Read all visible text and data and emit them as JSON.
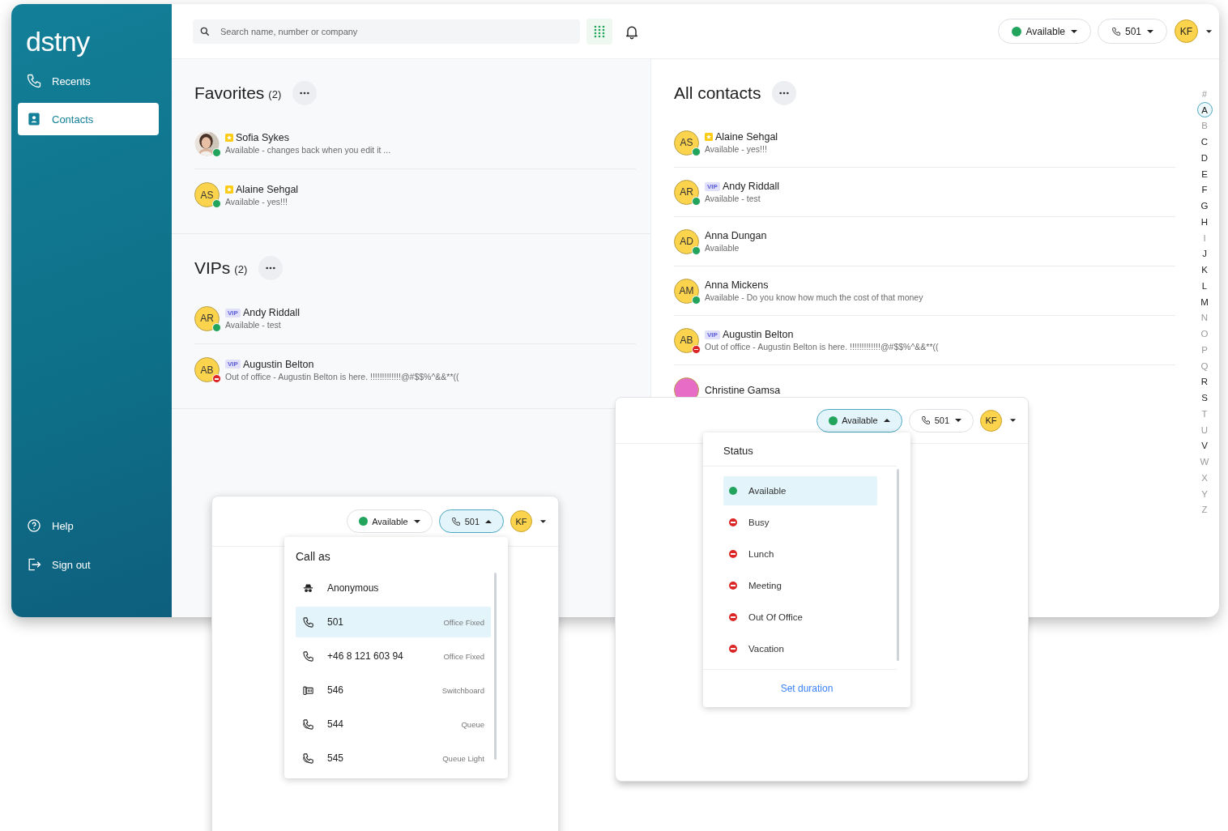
{
  "sidebar": {
    "logo": "dstny",
    "nav": [
      {
        "label": "Recents",
        "kind": "phone",
        "selected": false
      },
      {
        "label": "Contacts",
        "kind": "contacts",
        "selected": true
      }
    ],
    "footer": [
      {
        "label": "Help",
        "kind": "help"
      },
      {
        "label": "Sign out",
        "kind": "signout"
      }
    ]
  },
  "topbar": {
    "search": {
      "placeholder": "Search name, number or company"
    },
    "status": {
      "label": "Available",
      "color": "#22a45d",
      "open": false
    },
    "line": {
      "label": "501",
      "open": false
    },
    "user": {
      "initials": "KF"
    }
  },
  "sections": [
    {
      "title": "Favorites",
      "count": "(2)",
      "contacts": [
        {
          "name": "Sofia Sykes",
          "status": "Available - changes back when you edit it ...",
          "photo": true,
          "away": false,
          "badge": {
            "kind": "favorite"
          }
        },
        {
          "name": "Alaine Sehgal",
          "status": "Available - yes!!!",
          "initials": "AS",
          "color": "#fcd34d",
          "away": false,
          "badge": {
            "kind": "favorite"
          }
        }
      ]
    },
    {
      "title": "VIPs",
      "count": "(2)",
      "contacts": [
        {
          "name": "Andy Riddall",
          "status": "Available - test",
          "initials": "AR",
          "color": "#fcd34d",
          "away": false,
          "badge": {
            "kind": "vip",
            "text": "VIP"
          }
        },
        {
          "name": "Augustin Belton",
          "status": "Out of office - Augustin Belton is here. !!!!!!!!!!!!!@#$$%^&&**((",
          "initials": "AB",
          "color": "#fcd34d",
          "away": true,
          "badge": {
            "kind": "vip",
            "text": "VIP"
          }
        }
      ]
    }
  ],
  "all_contacts": {
    "title": "All contacts",
    "contacts": [
      {
        "name": "Alaine Sehgal",
        "status": "Available - yes!!!",
        "initials": "AS",
        "color": "#fcd34d",
        "away": false,
        "badge": {
          "kind": "favorite"
        }
      },
      {
        "name": "Andy Riddall",
        "status": "Available - test",
        "initials": "AR",
        "color": "#fcd34d",
        "away": false,
        "badge": {
          "kind": "vip",
          "text": "VIP"
        }
      },
      {
        "name": "Anna Dungan",
        "status": "Available",
        "initials": "AD",
        "color": "#fcd34d",
        "away": false
      },
      {
        "name": "Anna Mickens",
        "status": "Available - Do you know how much the cost of that money",
        "initials": "AM",
        "color": "#fcd34d",
        "away": false
      },
      {
        "name": "Augustin Belton",
        "status": "Out of office - Augustin Belton is here. !!!!!!!!!!!!!@#$$%^&&**((",
        "initials": "AB",
        "color": "#fcd34d",
        "away": true,
        "badge": {
          "kind": "vip",
          "text": "VIP"
        }
      },
      {
        "name": "Christine Gamsa",
        "color": "#e76cc6"
      }
    ],
    "index": [
      {
        "letter": "#",
        "selected": false,
        "disabled": true
      },
      {
        "letter": "A",
        "selected": true,
        "disabled": false
      },
      {
        "letter": "B",
        "selected": false,
        "disabled": true
      },
      {
        "letter": "C",
        "selected": false,
        "disabled": false
      },
      {
        "letter": "D",
        "selected": false,
        "disabled": false
      },
      {
        "letter": "E",
        "selected": false,
        "disabled": false
      },
      {
        "letter": "F",
        "selected": false,
        "disabled": false
      },
      {
        "letter": "G",
        "selected": false,
        "disabled": false
      },
      {
        "letter": "H",
        "selected": false,
        "disabled": false
      },
      {
        "letter": "I",
        "selected": false,
        "disabled": true
      },
      {
        "letter": "J",
        "selected": false,
        "disabled": false
      },
      {
        "letter": "K",
        "selected": false,
        "disabled": false
      },
      {
        "letter": "L",
        "selected": false,
        "disabled": false
      },
      {
        "letter": "M",
        "selected": false,
        "disabled": false
      },
      {
        "letter": "N",
        "selected": false,
        "disabled": true
      },
      {
        "letter": "O",
        "selected": false,
        "disabled": true
      },
      {
        "letter": "P",
        "selected": false,
        "disabled": true
      },
      {
        "letter": "Q",
        "selected": false,
        "disabled": true
      },
      {
        "letter": "R",
        "selected": false,
        "disabled": false
      },
      {
        "letter": "S",
        "selected": false,
        "disabled": false
      },
      {
        "letter": "T",
        "selected": false,
        "disabled": true
      },
      {
        "letter": "U",
        "selected": false,
        "disabled": true
      },
      {
        "letter": "V",
        "selected": false,
        "disabled": false
      },
      {
        "letter": "W",
        "selected": false,
        "disabled": true
      },
      {
        "letter": "X",
        "selected": false,
        "disabled": true
      },
      {
        "letter": "Y",
        "selected": false,
        "disabled": true
      },
      {
        "letter": "Z",
        "selected": false,
        "disabled": true
      }
    ]
  },
  "call_as_window": {
    "status": {
      "label": "Available",
      "color": "#22a45d",
      "open": false
    },
    "line": {
      "label": "501",
      "open": true
    },
    "user": {
      "initials": "KF"
    },
    "menu": {
      "title": "Call as",
      "items": [
        {
          "number": "Anonymous",
          "kind": "anonymous",
          "selected": false
        },
        {
          "number": "501",
          "type": "Office Fixed",
          "kind": "phone",
          "selected": true
        },
        {
          "number": "+46 8 121 603 94",
          "type": "Office Fixed",
          "kind": "phone",
          "selected": false
        },
        {
          "number": "546",
          "type": "Switchboard",
          "kind": "switchboard",
          "selected": false
        },
        {
          "number": "544",
          "type": "Queue",
          "kind": "queue",
          "selected": false
        },
        {
          "number": "545",
          "type": "Queue Light",
          "kind": "queue",
          "selected": false
        }
      ]
    }
  },
  "status_window": {
    "status": {
      "label": "Available",
      "color": "#22a45d",
      "open": true
    },
    "line": {
      "label": "501",
      "open": false
    },
    "user": {
      "initials": "KF"
    },
    "menu": {
      "title": "Status",
      "items": [
        {
          "label": "Available",
          "kind": "dot",
          "color": "#22a45d",
          "selected": true
        },
        {
          "label": "Busy",
          "kind": "blocked",
          "color": "#dc2626",
          "selected": false
        },
        {
          "label": "Lunch",
          "kind": "blocked",
          "color": "#dc2626",
          "selected": false
        },
        {
          "label": "Meeting",
          "kind": "blocked",
          "color": "#dc2626",
          "selected": false
        },
        {
          "label": "Out Of Office",
          "kind": "blocked",
          "color": "#dc2626",
          "selected": false
        },
        {
          "label": "Vacation",
          "kind": "blocked",
          "color": "#dc2626",
          "selected": false
        }
      ],
      "action": "Set duration"
    }
  }
}
